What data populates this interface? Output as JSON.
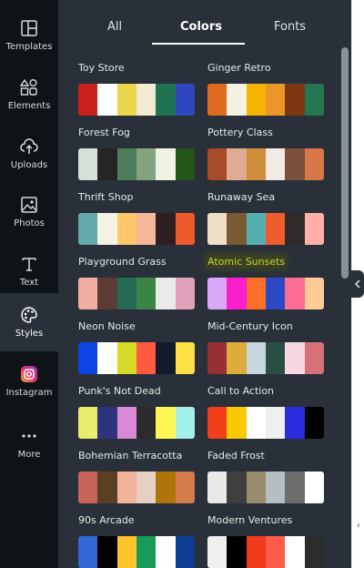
{
  "sidebar": {
    "items": [
      {
        "label": "Templates",
        "icon": "templates-icon"
      },
      {
        "label": "Elements",
        "icon": "elements-icon"
      },
      {
        "label": "Uploads",
        "icon": "uploads-icon"
      },
      {
        "label": "Photos",
        "icon": "photos-icon"
      },
      {
        "label": "Text",
        "icon": "text-icon"
      },
      {
        "label": "Styles",
        "icon": "styles-icon",
        "active": true
      },
      {
        "label": "Instagram",
        "icon": "instagram-icon"
      },
      {
        "label": "More",
        "icon": "more-icon"
      }
    ]
  },
  "tabs": [
    {
      "label": "All"
    },
    {
      "label": "Colors",
      "active": true
    },
    {
      "label": "Fonts"
    }
  ],
  "palettes": [
    {
      "name": "Toy Store",
      "colors": [
        "#c9201d",
        "#ffffff",
        "#ead64a",
        "#f3ead4",
        "#207350",
        "#2f46be"
      ]
    },
    {
      "name": "Ginger Retro",
      "colors": [
        "#e06b20",
        "#f5f1e1",
        "#f5b401",
        "#eb9628",
        "#7c3811",
        "#247650"
      ]
    },
    {
      "name": "Forest Fog",
      "colors": [
        "#d4e1d6",
        "#252526",
        "#4d7d5a",
        "#84a37e",
        "#f1f2e4",
        "#245519"
      ]
    },
    {
      "name": "Pottery Class",
      "colors": [
        "#a64c26",
        "#dfab92",
        "#ce8f3c",
        "#f2ebe5",
        "#7a4f3b",
        "#d67649"
      ]
    },
    {
      "name": "Thrift Shop",
      "colors": [
        "#63aaaa",
        "#f5f3e4",
        "#fec86a",
        "#f6b698",
        "#2e2022",
        "#ef5a2d"
      ]
    },
    {
      "name": "Runaway Sea",
      "colors": [
        "#f1e0c6",
        "#7a5a33",
        "#55afb1",
        "#ef5c2e",
        "#2f2b2b",
        "#feb0a8"
      ]
    },
    {
      "name": "Playground Grass",
      "colors": [
        "#f0afa0",
        "#5c3a36",
        "#256b54",
        "#3b8446",
        "#eaeaea",
        "#e2a1bb"
      ]
    },
    {
      "name": "Atomic Sunsets",
      "highlight": true,
      "colors": [
        "#daaaf9",
        "#fa1ecb",
        "#fe6f29",
        "#2d49c5",
        "#fd6c95",
        "#fecb94"
      ]
    },
    {
      "name": "Neon Noise",
      "colors": [
        "#0f44e5",
        "#ffffff",
        "#d5db28",
        "#ff5a40",
        "#131a2a",
        "#fde044"
      ]
    },
    {
      "name": "Mid-Century Icon",
      "colors": [
        "#963033",
        "#deac3b",
        "#c8d7de",
        "#2b4e45",
        "#f8d7e2",
        "#d67079"
      ]
    },
    {
      "name": "Punk's Not Dead",
      "colors": [
        "#e8ed6e",
        "#2e347c",
        "#d989d6",
        "#2b2b2e",
        "#fef655",
        "#a3f0ea"
      ]
    },
    {
      "name": "Call to Action",
      "colors": [
        "#f23e1b",
        "#f7c804",
        "#ffffff",
        "#efefef",
        "#2a2bde",
        "#000000"
      ]
    },
    {
      "name": "Bohemian Terracotta",
      "colors": [
        "#c86559",
        "#5b3f24",
        "#f2b39b",
        "#e6d0c3",
        "#b07509",
        "#d47b4b"
      ]
    },
    {
      "name": "Faded Frost",
      "colors": [
        "#e9e9e9",
        "#3f3f3f",
        "#978b6b",
        "#b4bec3",
        "#6c6c6c",
        "#ffffff"
      ]
    },
    {
      "name": "90s Arcade",
      "colors": [
        "#3267d6",
        "#000000",
        "#fdc52b",
        "#189b59",
        "#ffffff",
        "#0c3f93"
      ]
    },
    {
      "name": "Modern Ventures",
      "colors": [
        "#f0f0f0",
        "#000000",
        "#f13a1b",
        "#fe5b4d",
        "#ffffff",
        "#2c2c2c"
      ]
    }
  ],
  "icons": {
    "collapse": "chevron-left-icon"
  }
}
